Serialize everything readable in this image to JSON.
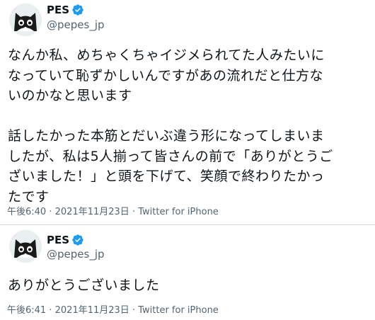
{
  "tweets": [
    {
      "author": {
        "name": "PES",
        "handle": "@pepes_jp",
        "verified_icon": "verified-badge-icon",
        "avatar_icon": "cat-avatar-icon"
      },
      "lines": [
        "なんか私、めちゃくちゃイジメられてた人みたいに",
        "なっていて恥ずかしいんですがあの流れだと仕方な",
        "いのかなと思います",
        "",
        "話したかった本筋とだいぶ違う形になってしまいま",
        "したが、私は5人揃って皆さんの前で「ありがとうご",
        "ざいました！」と頭を下げて、笑顔で終わりたかっ",
        "たです"
      ],
      "time": "午後6:40",
      "date": "2021年11月23日",
      "source": "Twitter for iPhone",
      "separator": "·"
    },
    {
      "author": {
        "name": "PES",
        "handle": "@pepes_jp",
        "verified_icon": "verified-badge-icon",
        "avatar_icon": "cat-avatar-icon"
      },
      "lines": [
        "ありがとうございました"
      ],
      "time": "午後6:41",
      "date": "2021年11月23日",
      "source": "Twitter for iPhone",
      "separator": "·"
    }
  ],
  "colors": {
    "verified": "#1d9bf0",
    "secondary_text": "#536471",
    "text": "#0f1419",
    "divider": "#cfd9de"
  }
}
